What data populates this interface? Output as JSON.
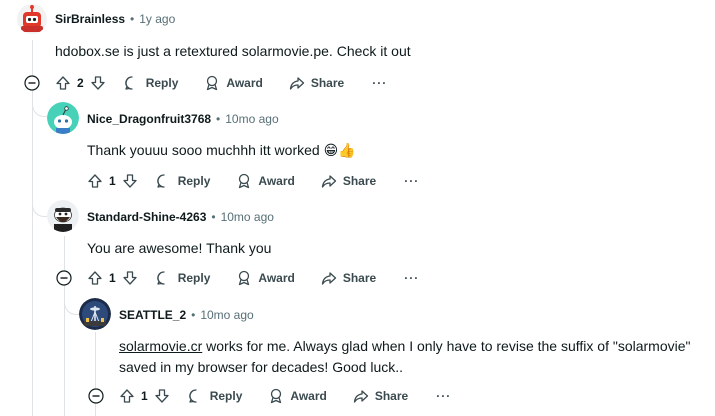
{
  "comments": [
    {
      "author": "SirBrainless",
      "time": "1y ago",
      "text": "hdobox.se is just a retextured solarmovie.pe. Check it out",
      "votes": "2",
      "reply_label": "Reply",
      "award_label": "Award",
      "share_label": "Share",
      "more_label": "···",
      "avatar_icon": "red-robot-avatar"
    },
    {
      "author": "Nice_Dragonfruit3768",
      "time": "10mo ago",
      "text": "Thank youuu sooo muchhh itt worked",
      "emoji": "😁👍",
      "votes": "1",
      "reply_label": "Reply",
      "award_label": "Award",
      "share_label": "Share",
      "more_label": "···",
      "avatar_icon": "snoo-teal-avatar"
    },
    {
      "author": "Standard-Shine-4263",
      "time": "10mo ago",
      "text": "You are awesome! Thank you",
      "votes": "1",
      "reply_label": "Reply",
      "award_label": "Award",
      "share_label": "Share",
      "more_label": "···",
      "avatar_icon": "bearded-snoo-avatar"
    },
    {
      "author": "SEATTLE_2",
      "time": "10mo ago",
      "link_text": "solarmovie.cr",
      "text_line1": " works for me. Always glad when I only have to revise the suffix of \"solarmovie\"",
      "text_line2": "saved in my browser for decades! Good luck..",
      "votes": "1",
      "reply_label": "Reply",
      "award_label": "Award",
      "share_label": "Share",
      "more_label": "···",
      "avatar_icon": "space-needle-avatar"
    }
  ],
  "colors": {
    "text": "#0f1a1c",
    "meta": "#576f76",
    "thread_line": "#dfe3e5",
    "accent_red": "#d93a00"
  }
}
